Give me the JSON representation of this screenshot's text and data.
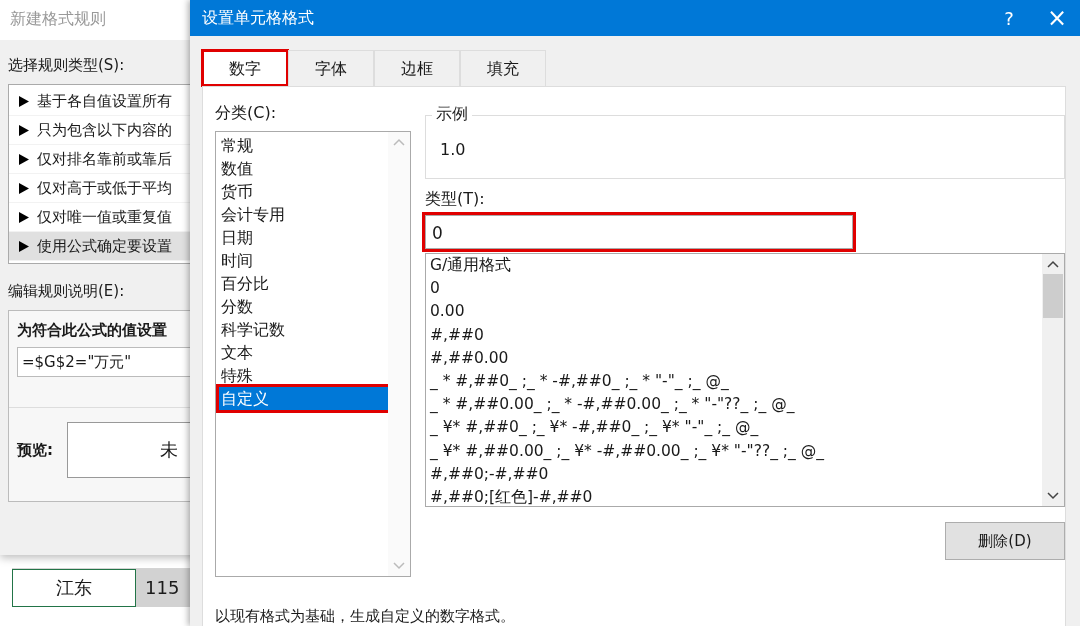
{
  "back_dialog": {
    "title": "新建格式规则",
    "rule_type_label": "选择规则类型(S):",
    "rule_types": [
      {
        "label": "基于各自值设置所有",
        "selected": false
      },
      {
        "label": "只为包含以下内容的",
        "selected": false
      },
      {
        "label": "仅对排名靠前或靠后",
        "selected": false
      },
      {
        "label": "仅对高于或低于平均",
        "selected": false
      },
      {
        "label": "仅对唯一值或重复值",
        "selected": false
      },
      {
        "label": "使用公式确定要设置",
        "selected": true
      }
    ],
    "description_label": "编辑规则说明(E):",
    "formula_heading": "为符合此公式的值设置",
    "formula": "=$G$2=\"万元\"",
    "preview_label": "预览:",
    "preview_text": "未"
  },
  "sheet": {
    "cells": [
      {
        "text": "江东",
        "selected": false
      },
      {
        "text": "115",
        "selected": true
      }
    ]
  },
  "dialog": {
    "title": "设置单元格格式",
    "help": "?",
    "close": "×",
    "tabs": [
      {
        "label": "数字",
        "selected": true,
        "highlight": true
      },
      {
        "label": "字体",
        "selected": false,
        "highlight": false
      },
      {
        "label": "边框",
        "selected": false,
        "highlight": false
      },
      {
        "label": "填充",
        "selected": false,
        "highlight": false
      }
    ],
    "category_label": "分类(C):",
    "categories": [
      {
        "label": "常规",
        "selected": false,
        "highlight": false
      },
      {
        "label": "数值",
        "selected": false,
        "highlight": false
      },
      {
        "label": "货币",
        "selected": false,
        "highlight": false
      },
      {
        "label": "会计专用",
        "selected": false,
        "highlight": false
      },
      {
        "label": "日期",
        "selected": false,
        "highlight": false
      },
      {
        "label": "时间",
        "selected": false,
        "highlight": false
      },
      {
        "label": "百分比",
        "selected": false,
        "highlight": false
      },
      {
        "label": "分数",
        "selected": false,
        "highlight": false
      },
      {
        "label": "科学记数",
        "selected": false,
        "highlight": false
      },
      {
        "label": "文本",
        "selected": false,
        "highlight": false
      },
      {
        "label": "特殊",
        "selected": false,
        "highlight": false
      },
      {
        "label": "自定义",
        "selected": true,
        "highlight": true
      }
    ],
    "sample_label": "示例",
    "sample_value": "1.0",
    "type_label": "类型(T):",
    "type_value": "0",
    "type_highlight": true,
    "formats": [
      "G/通用格式",
      "0",
      "0.00",
      "#,##0",
      "#,##0.00",
      "_ * #,##0_ ;_ * -#,##0_ ;_ * \"-\"_ ;_ @_",
      "_ * #,##0.00_ ;_ * -#,##0.00_ ;_ * \"-\"??_ ;_ @_",
      "_ ¥* #,##0_ ;_ ¥* -#,##0_ ;_ ¥* \"-\"_ ;_ @_",
      "_ ¥* #,##0.00_ ;_ ¥* -#,##0.00_ ;_ ¥* \"-\"??_ ;_ @_",
      "#,##0;-#,##0",
      "#,##0;[红色]-#,##0"
    ],
    "delete_button": "删除(D)",
    "hint": "以现有格式为基础，生成自定义的数字格式。"
  }
}
